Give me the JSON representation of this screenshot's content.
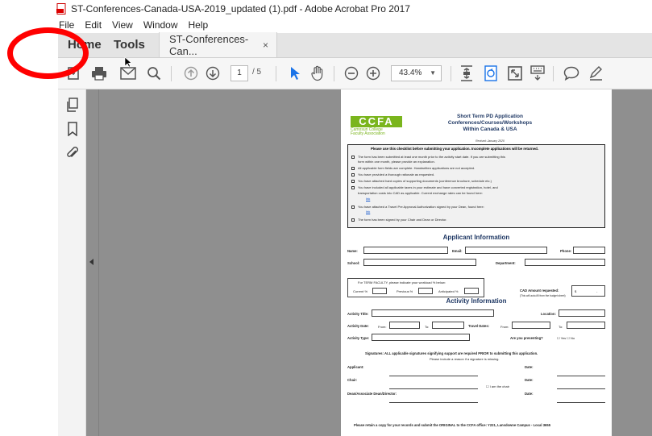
{
  "window": {
    "title": "ST-Conferences-Canada-USA-2019_updated (1).pdf - Adobe Acrobat Pro 2017"
  },
  "menu": [
    "File",
    "Edit",
    "View",
    "Window",
    "Help"
  ],
  "tabs": {
    "home": "Home",
    "tools": "Tools",
    "doc": "ST-Conferences-Can...",
    "close": "×"
  },
  "toolbar": {
    "page_current": "1",
    "page_total": "/ 5",
    "zoom": "43.4%"
  },
  "icons": {
    "toolbar": [
      "create-icon",
      "print-icon",
      "email-icon",
      "search-icon",
      "page-up-icon",
      "page-down-icon",
      "select-arrow-icon",
      "hand-icon",
      "zoom-out-icon",
      "zoom-in-icon",
      "fit-page-icon",
      "rotate-icon",
      "fullscreen-icon",
      "keyboard-icon",
      "comment-icon",
      "sign-icon"
    ],
    "leftnav": [
      "pages-icon",
      "bookmark-icon",
      "attachment-icon"
    ]
  },
  "document": {
    "logo": {
      "text": "CCFA",
      "sub1": "Camosun College",
      "sub2": "Faculty Association"
    },
    "header": {
      "line1": "Short Term PD Application",
      "line2": "Conferences/Courses/Workshops",
      "line3": "Within Canada & USA",
      "revised": "Revised: January 2020"
    },
    "checklist_title": "Please use this checklist before submitting your application. Incomplete applications will be returned.",
    "checklist": [
      "The form has been submitted at least one month prior to the activity start date. If you are submitting this",
      "form within one month, please provide an explanation.",
      "All applicable form fields are complete. Handwritten applications are not accepted.",
      "You have provided a thorough rationale as requested.",
      "You have attached hard copies of supporting documents (conference brochure, schedule etc.)",
      "You have included all applicable taxes in your estimate and have converted registration, hotel, and",
      "transportation costs into CAD as applicable. Current exchange rates can be found here:",
      "You have attached a Travel Pre Approval Authorization signed by your Dean, found here:",
      "The form has been signed by your Chair and Dean or Director."
    ],
    "link": "link",
    "applicant_title": "Applicant Information",
    "labels": {
      "name": "Name:",
      "email": "Email:",
      "phone": "Phone:",
      "school": "School:",
      "department": "Department:",
      "term_note": "For TERM FACULTY, please indicate your workload % below:",
      "current": "Current %",
      "previous": "Previous %",
      "anticipated": "Anticipated %",
      "cad": "CAD Amount requested:",
      "cad_note": "(This will auto-fill from the budget sheet)",
      "cad_value": "$",
      "cad_dash": "-",
      "activity_title_hdr": "Activity Information",
      "activity_title": "Activity Title:",
      "location": "Location:",
      "activity_date": "Activity Date:",
      "from": "From:",
      "to": "To:",
      "travel_dates": "Travel Dates:",
      "activity_type": "Activity Type:",
      "presenting": "Are you presenting?",
      "yes": "Yes",
      "no": "No",
      "sig_note": "Signatures: ALL applicable signatures signifying support are required PRIOR to submitting this application.",
      "sig_note2": "Please include a reason if a signature is missing.",
      "applicant": "Applicant:",
      "chair": "Chair:",
      "dean": "Dean/Associate Dean/Director:",
      "date": "Date:",
      "iam_chair": "I am the chair",
      "footer": "Please retain a copy for your records and submit the ORIGINAL to the CCFA office: Y221, Lansdowne Campus - Local 3655"
    }
  }
}
